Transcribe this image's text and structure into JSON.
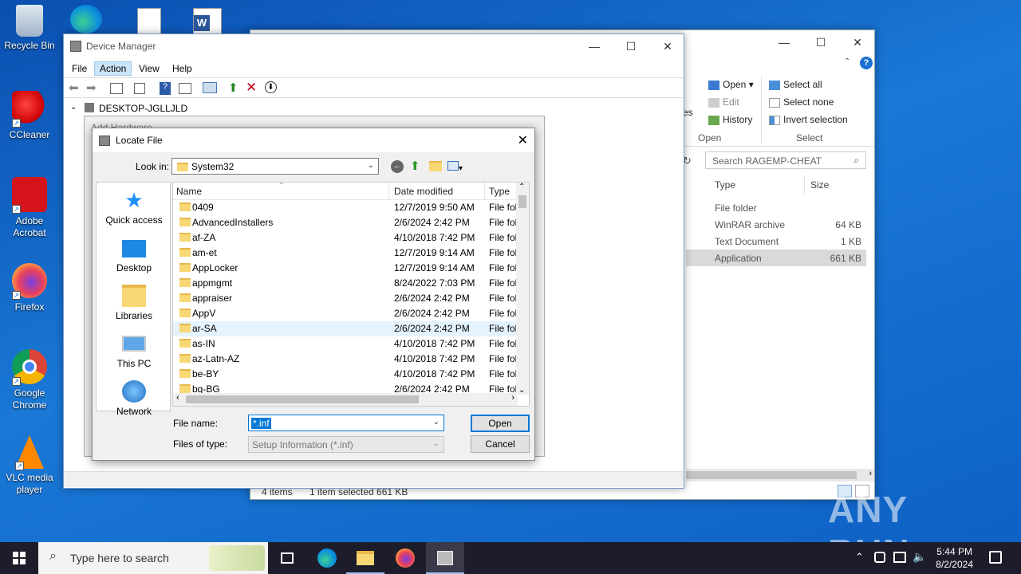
{
  "desktop": {
    "icons": [
      {
        "label": "Recycle Bin"
      },
      {
        "label": "CCleaner"
      },
      {
        "label": "Adobe Acrobat"
      },
      {
        "label": "Firefox"
      },
      {
        "label": "Google Chrome"
      },
      {
        "label": "VLC media player"
      }
    ]
  },
  "explorer": {
    "ribbon": {
      "open": "Open",
      "edit": "Edit",
      "history": "History",
      "open_group": "Open",
      "select_all": "Select all",
      "select_none": "Select none",
      "invert_selection": "Invert selection",
      "select_group": "Select",
      "properties_partial": "rties"
    },
    "search_placeholder": "Search RAGEMP-CHEAT",
    "columns": {
      "type": "Type",
      "size": "Size"
    },
    "rows": [
      {
        "type": "File folder",
        "size": ""
      },
      {
        "type": "WinRAR archive",
        "size": "64 KB"
      },
      {
        "type": "Text Document",
        "size": "1 KB"
      },
      {
        "type": "Application",
        "size": "661 KB"
      }
    ],
    "status": {
      "items": "4 items",
      "selected": "1 item selected  661 KB"
    }
  },
  "device_manager": {
    "title": "Device Manager",
    "menu": {
      "file": "File",
      "action": "Action",
      "view": "View",
      "help": "Help"
    },
    "tree_root": "DESKTOP-JGLLJLD",
    "behind_text": "Add Hardware"
  },
  "locate_file": {
    "title": "Locate File",
    "look_in_label": "Look in:",
    "look_in_value": "System32",
    "places": [
      {
        "label": "Quick access"
      },
      {
        "label": "Desktop"
      },
      {
        "label": "Libraries"
      },
      {
        "label": "This PC"
      },
      {
        "label": "Network"
      }
    ],
    "columns": {
      "name": "Name",
      "date": "Date modified",
      "type": "Type"
    },
    "files": [
      {
        "name": "0409",
        "date": "12/7/2019 9:50 AM",
        "type": "File folder"
      },
      {
        "name": "AdvancedInstallers",
        "date": "2/6/2024 2:42 PM",
        "type": "File folder"
      },
      {
        "name": "af-ZA",
        "date": "4/10/2018 7:42 PM",
        "type": "File folder"
      },
      {
        "name": "am-et",
        "date": "12/7/2019 9:14 AM",
        "type": "File folder"
      },
      {
        "name": "AppLocker",
        "date": "12/7/2019 9:14 AM",
        "type": "File folder"
      },
      {
        "name": "appmgmt",
        "date": "8/24/2022 7:03 PM",
        "type": "File folder"
      },
      {
        "name": "appraiser",
        "date": "2/6/2024 2:42 PM",
        "type": "File folder"
      },
      {
        "name": "AppV",
        "date": "2/6/2024 2:42 PM",
        "type": "File folder"
      },
      {
        "name": "ar-SA",
        "date": "2/6/2024 2:42 PM",
        "type": "File folder"
      },
      {
        "name": "as-IN",
        "date": "4/10/2018 7:42 PM",
        "type": "File folder"
      },
      {
        "name": "az-Latn-AZ",
        "date": "4/10/2018 7:42 PM",
        "type": "File folder"
      },
      {
        "name": "be-BY",
        "date": "4/10/2018 7:42 PM",
        "type": "File folder"
      },
      {
        "name": "bg-BG",
        "date": "2/6/2024 2:42 PM",
        "type": "File folder"
      }
    ],
    "file_name_label": "File name:",
    "file_name_value": "*.inf",
    "files_of_type_label": "Files of type:",
    "files_of_type_value": "Setup Information (*.inf)",
    "open_button": "Open",
    "cancel_button": "Cancel"
  },
  "taskbar": {
    "search_placeholder": "Type here to search",
    "time": "5:44 PM",
    "date": "8/2/2024"
  },
  "watermark": "ANY RUN"
}
